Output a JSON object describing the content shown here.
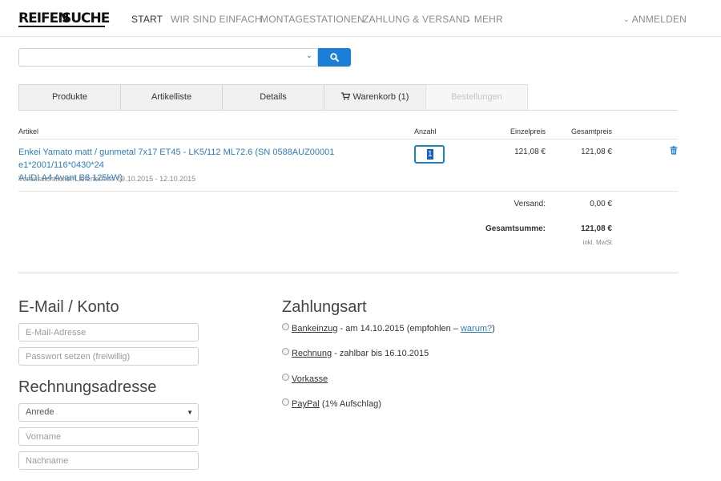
{
  "brand": {
    "logo_left": "REIFEN",
    "logo_right": "SUCHE"
  },
  "nav": {
    "start": "START",
    "simple": "WIR SIND EINFACH",
    "stations": "MONTAGESTATIONEN",
    "payment": "ZAHLUNG & VERSAND",
    "more": "MEHR",
    "login": "ANMELDEN"
  },
  "search": {
    "value": ""
  },
  "tabs": [
    {
      "label": "Produkte"
    },
    {
      "label": "Artikelliste"
    },
    {
      "label": "Details"
    },
    {
      "label": "Warenkorb (1)"
    },
    {
      "label": "Bestellungen"
    }
  ],
  "cart": {
    "headers": {
      "article": "Artikel",
      "qty": "Anzahl",
      "unit_price": "Einzelpreis",
      "total_price": "Gesamtpreis"
    },
    "item": {
      "title_line1": "Enkei Yamato matt / gunmetal 7x17 ET45 - LK5/112 ML72.6 (SN 0588AUZ00001 e1*2001/116*0430*24",
      "title_line2": "AUDI A4 Avant B8 125kW)",
      "delivery": "Voraussichtlicher Liefertermin: 09.10.2015 - 12.10.2015",
      "qty": "1",
      "unit_price": "121,08 €",
      "total_price": "121,08 €"
    },
    "shipping_label": "Versand:",
    "shipping_value": "0,00 €",
    "total_label": "Gesamtsumme:",
    "total_value": "121,08 €",
    "vat_note": "inkl. MwSt"
  },
  "account": {
    "heading": "E-Mail / Konto",
    "email_placeholder": "E-Mail-Adresse",
    "password_placeholder": "Passwort setzen (freiwillig)"
  },
  "billing": {
    "heading": "Rechnungsadresse",
    "salutation": "Anrede",
    "first_name_placeholder": "Vorname",
    "last_name_placeholder": "Nachname"
  },
  "payment": {
    "heading": "Zahlungsart",
    "options": [
      {
        "name": "Bankeinzug",
        "detail_before": " - am 14.10.2015 (empfohlen – ",
        "link": "warum?",
        "detail_after": ")"
      },
      {
        "name": "Rechnung",
        "detail": " - zahlbar bis 16.10.2015"
      },
      {
        "name": "Vorkasse",
        "detail": ""
      },
      {
        "name": "PayPal",
        "detail": " (1% Aufschlag)"
      }
    ]
  }
}
